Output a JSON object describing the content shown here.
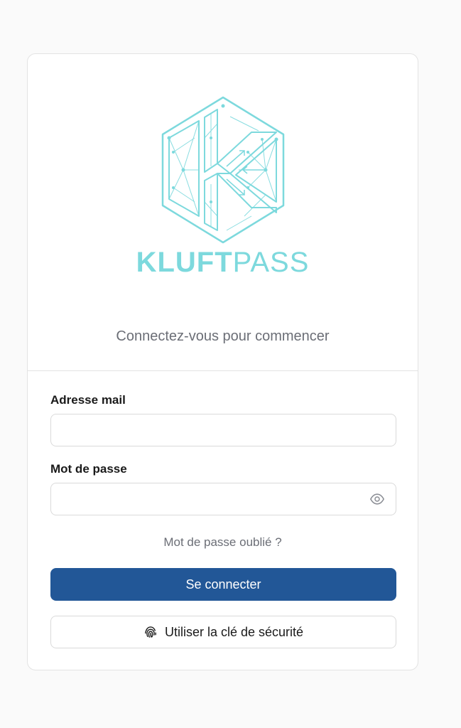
{
  "brand": {
    "name_bold": "KLUFT",
    "name_light": "PASS",
    "accent_color": "#7dd9dd",
    "logo_icon": "kluftpass-hexagon-logo"
  },
  "header": {
    "subtitle": "Connectez-vous pour commencer"
  },
  "form": {
    "email": {
      "label": "Adresse mail",
      "value": "",
      "placeholder": ""
    },
    "password": {
      "label": "Mot de passe",
      "value": "",
      "placeholder": "",
      "toggle_icon": "eye-icon"
    },
    "forgot_link": "Mot de passe oublié ?",
    "submit_label": "Se connecter",
    "security_key_label": "Utiliser la clé de sécurité",
    "security_key_icon": "fingerprint-icon"
  },
  "colors": {
    "primary_button": "#225797",
    "page_background": "#fafafa",
    "muted_text": "#6b6e76"
  }
}
